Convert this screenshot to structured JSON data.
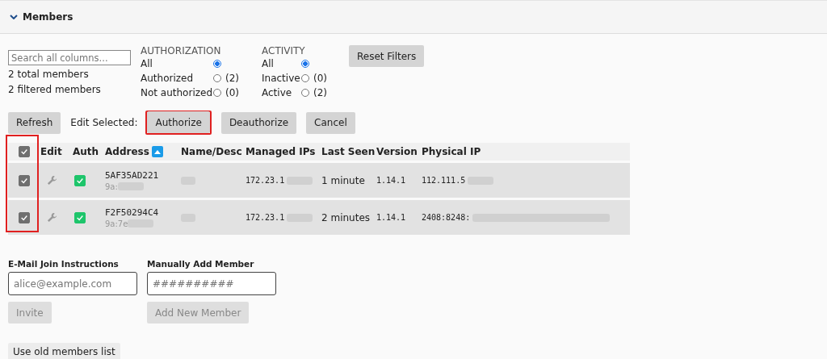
{
  "section": {
    "title": "Members",
    "expanded": true
  },
  "search": {
    "placeholder": "Search all columns..."
  },
  "counts": [
    "2 total members",
    "2 filtered members"
  ],
  "filters": [
    {
      "title": "AUTHORIZATION",
      "options": [
        {
          "label": "All",
          "selected": true
        },
        {
          "label": "Authorized",
          "count": "(2)",
          "selected": false
        },
        {
          "label": "Not authorized",
          "count": "(0)",
          "selected": false
        }
      ]
    },
    {
      "title": "ACTIVITY",
      "options": [
        {
          "label": "All",
          "selected": true
        },
        {
          "label": "Inactive",
          "count": "(0)",
          "selected": false
        },
        {
          "label": "Active",
          "count": "(2)",
          "selected": false
        }
      ]
    }
  ],
  "reset_button": "Reset Filters",
  "refresh_button": "Refresh",
  "edit_label": "Edit Selected:",
  "edit_buttons": [
    {
      "label": "Authorize",
      "highlighted": true
    },
    {
      "label": "Deauthorize",
      "highlighted": false
    },
    {
      "label": "Cancel",
      "highlighted": false
    }
  ],
  "table": {
    "select_all": true,
    "columns": [
      "Edit",
      "Auth",
      "Address",
      "Name/Desc",
      "Managed IPs",
      "Last Seen",
      "Version",
      "Physical IP"
    ],
    "rows": [
      {
        "checked": true,
        "authorized": true,
        "address": "5AF35AD221",
        "mac": "9a:",
        "managed_ip": "172.23.1",
        "last_seen": "1 minute",
        "version": "1.14.1",
        "physical_ip": "112.111.5"
      },
      {
        "checked": true,
        "authorized": true,
        "address": "F2F50294C4",
        "mac": "9a:7e",
        "managed_ip": "172.23.1",
        "last_seen": "2 minutes",
        "version": "1.14.1",
        "physical_ip": "2408:8248:"
      }
    ]
  },
  "invite": {
    "label": "E-Mail Join Instructions",
    "placeholder": "alice@example.com",
    "button": "Invite",
    "disabled": true
  },
  "add_member": {
    "label": "Manually Add Member",
    "placeholder": "##########",
    "button": "Add New Member",
    "disabled": true
  },
  "old_list_button": "Use old members list"
}
